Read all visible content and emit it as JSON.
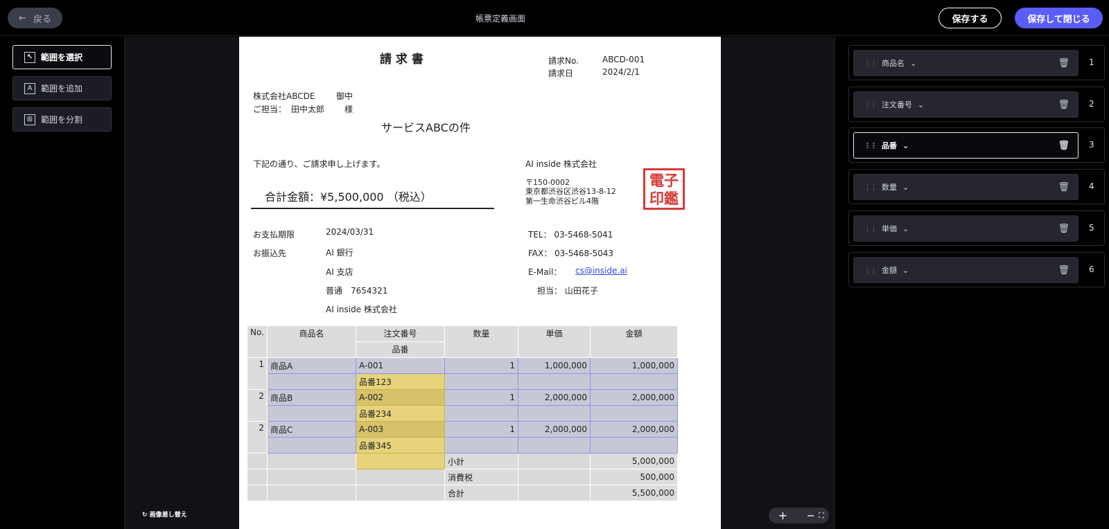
{
  "header": {
    "back_label": "戻る",
    "title": "帳票定義画面",
    "save_label": "保存する",
    "save_close_label": "保存して閉じる"
  },
  "tools": [
    {
      "label": "範囲を選択",
      "icon": "select-range-icon",
      "active": true
    },
    {
      "label": "範囲を追加",
      "icon": "add-range-icon",
      "active": false
    },
    {
      "label": "範囲を分割",
      "icon": "split-range-icon",
      "active": false
    }
  ],
  "swap_image_label": "画像差し替え",
  "zoom": {
    "in": "+",
    "out": "−"
  },
  "document": {
    "title": "請 求 書",
    "invoice_no_label": "請求No.",
    "invoice_no": "ABCD-001",
    "invoice_date_label": "請求日",
    "invoice_date": "2024/2/1",
    "to_company": "株式会社ABCDE",
    "to_honorific": "御中",
    "contact_label": "ご担当：",
    "contact_name": "田中太郎",
    "contact_honorific": "様",
    "subject": "サービスABCの件",
    "intro": "下記の通り、ご請求申し上げます。",
    "total_amount_text": "合計金額：¥5,500,000 （税込）",
    "issuer_company": "AI inside 株式会社",
    "issuer_postal": "〒150-0002",
    "issuer_address1": "東京都渋谷区渋谷13-8-12",
    "issuer_address2": "第一生命渋谷ビル4階",
    "seal_text": "電子印鑑",
    "due_label": "お支払期限",
    "due_date": "2024/03/31",
    "transfer_label": "お振込先",
    "bank": "AI 銀行",
    "branch": "AI 支店",
    "account": "普通　7654321",
    "account_holder": "AI inside 株式会社",
    "tel": "TEL： 03-5468-5041",
    "fax": "FAX： 03-5468-5043",
    "email_label": "E-Mail：",
    "email": "cs@inside.ai",
    "person": "担当： 山田花子",
    "table": {
      "headers": [
        "No.",
        "商品名",
        "注文番号",
        "数量",
        "単価",
        "金額"
      ],
      "subheader": "品番",
      "rows": [
        {
          "no": "1",
          "name": "商品A",
          "order": "A-001",
          "part": "品番123",
          "qty": "1",
          "price": "1,000,000",
          "amount": "1,000,000"
        },
        {
          "no": "2",
          "name": "商品B",
          "order": "A-002",
          "part": "品番234",
          "qty": "1",
          "price": "2,000,000",
          "amount": "2,000,000"
        },
        {
          "no": "2",
          "name": "商品C",
          "order": "A-003",
          "part": "品番345",
          "qty": "1",
          "price": "2,000,000",
          "amount": "2,000,000"
        }
      ],
      "subtotal_label": "小計",
      "subtotal": "5,000,000",
      "tax_label": "消費税",
      "tax": "500,000",
      "total_label": "合計",
      "total": "5,500,000"
    }
  },
  "fields": [
    {
      "label": "商品名",
      "index": "1"
    },
    {
      "label": "注文番号",
      "index": "2"
    },
    {
      "label": "品番",
      "index": "3"
    },
    {
      "label": "数量",
      "index": "4"
    },
    {
      "label": "単価",
      "index": "5"
    },
    {
      "label": "金額",
      "index": "6"
    }
  ],
  "active_field": 2,
  "colors": {
    "accent": "#5a5df7",
    "selection": "#8f93e8",
    "highlight": "#e6d37c",
    "seal": "#d83a35"
  }
}
